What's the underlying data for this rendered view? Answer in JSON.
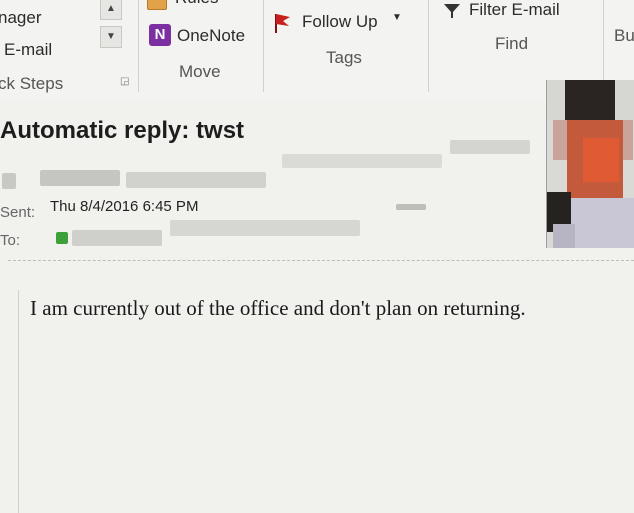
{
  "ribbon": {
    "left_group": {
      "item1": "nager",
      "item2": "E-mail",
      "label": "ck Steps"
    },
    "move_group": {
      "rules_label": "Rules",
      "onenote_label": "OneNote",
      "label": "Move"
    },
    "tags_group": {
      "follow_up_label": "Follow Up",
      "label": "Tags"
    },
    "find_group": {
      "filter_label": "Filter E-mail",
      "label": "Find"
    },
    "partial_group": {
      "label": "Bu"
    }
  },
  "message": {
    "subject": "Automatic reply: twst",
    "sent_label": "Sent:",
    "sent_value": "Thu 8/4/2016 6:45 PM",
    "to_label": "To:",
    "body": "I am currently out of the office and don't plan on returning."
  },
  "colors": {
    "onenote_purple": "#7b2fa0",
    "flag_red": "#c8201f",
    "ribbon_bg": "#f3f3f1",
    "reading_bg": "#f1f1ee"
  }
}
